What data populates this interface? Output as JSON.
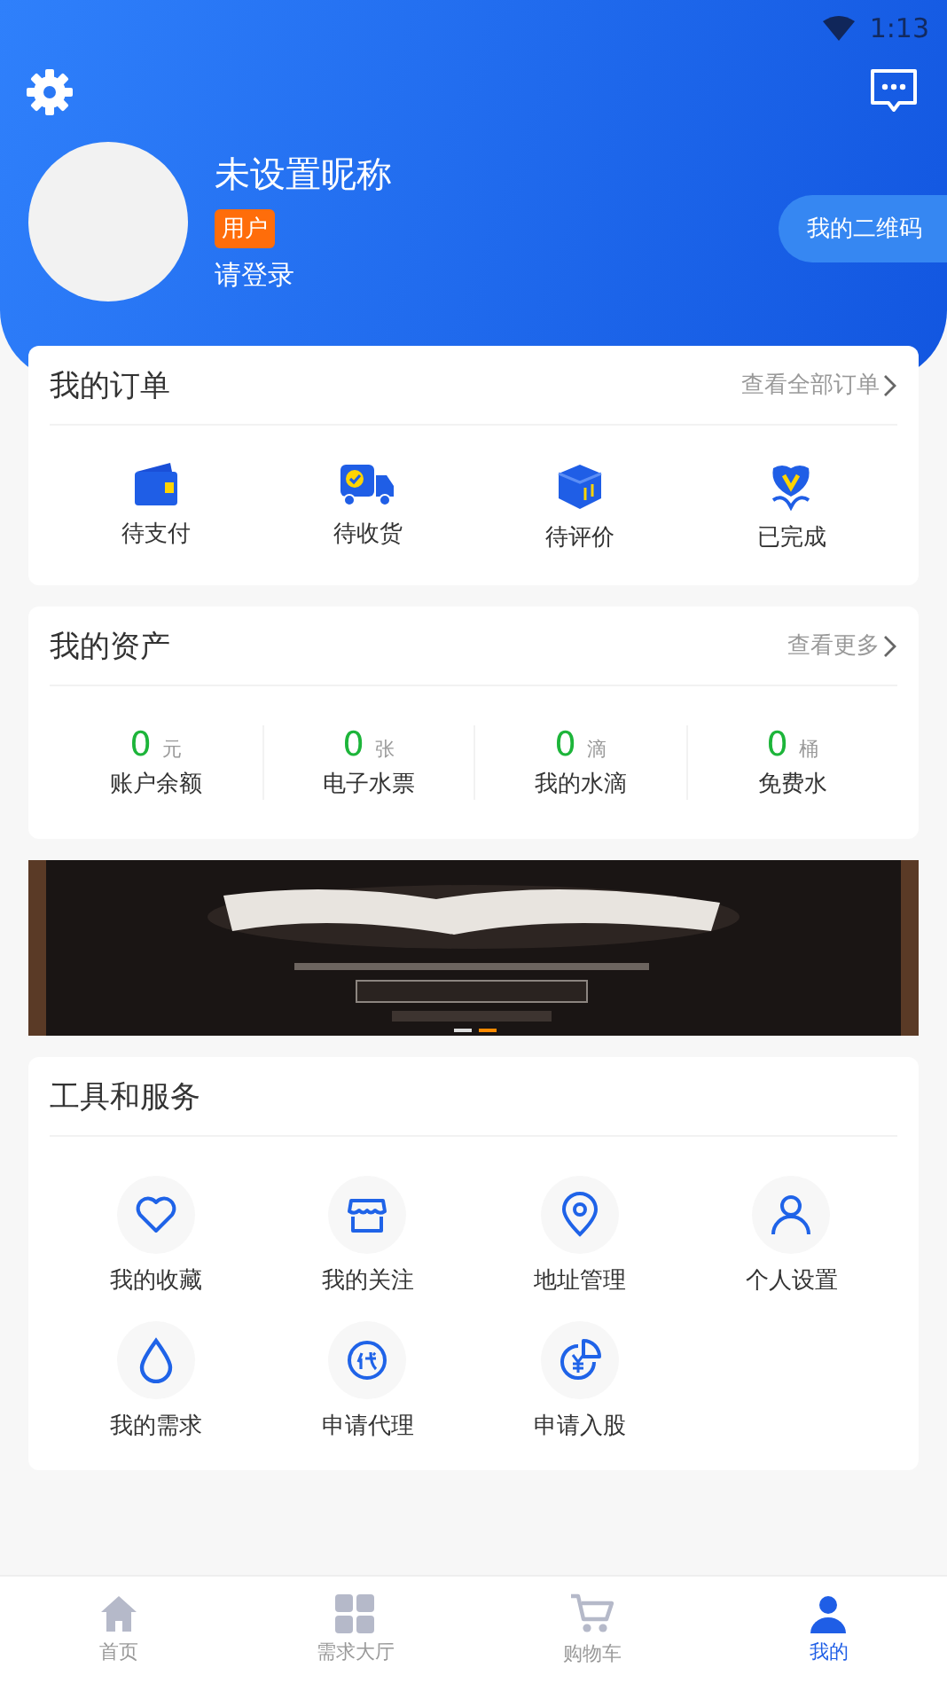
{
  "status_bar": {
    "time": "1:13"
  },
  "profile": {
    "nickname": "未设置昵称",
    "badge": "用户",
    "login": "请登录",
    "qr_button": "我的二维码"
  },
  "orders": {
    "title": "我的订单",
    "more": "查看全部订单",
    "items": [
      {
        "kind": "wallet",
        "label": "待支付"
      },
      {
        "kind": "truck",
        "label": "待收货"
      },
      {
        "kind": "box",
        "label": "待评价"
      },
      {
        "kind": "flower",
        "label": "已完成"
      }
    ]
  },
  "assets": {
    "title": "我的资产",
    "more": "查看更多",
    "items": [
      {
        "value": "0",
        "unit": "元",
        "label": "账户余额"
      },
      {
        "value": "0",
        "unit": "张",
        "label": "电子水票"
      },
      {
        "value": "0",
        "unit": "滴",
        "label": "我的水滴"
      },
      {
        "value": "0",
        "unit": "桶",
        "label": "免费水"
      }
    ]
  },
  "tools": {
    "title": "工具和服务",
    "items": [
      {
        "kind": "heart",
        "label": "我的收藏"
      },
      {
        "kind": "shop",
        "label": "我的关注"
      },
      {
        "kind": "pin",
        "label": "地址管理"
      },
      {
        "kind": "person",
        "label": "个人设置"
      },
      {
        "kind": "drop",
        "label": "我的需求"
      },
      {
        "kind": "agent",
        "label": "申请代理"
      },
      {
        "kind": "share",
        "label": "申请入股"
      }
    ]
  },
  "tab_bar": [
    {
      "kind": "home",
      "label": "首页",
      "selected": false
    },
    {
      "kind": "grid",
      "label": "需求大厅",
      "selected": false
    },
    {
      "kind": "cart",
      "label": "购物车",
      "selected": false
    },
    {
      "kind": "user",
      "label": "我的",
      "selected": true
    }
  ]
}
